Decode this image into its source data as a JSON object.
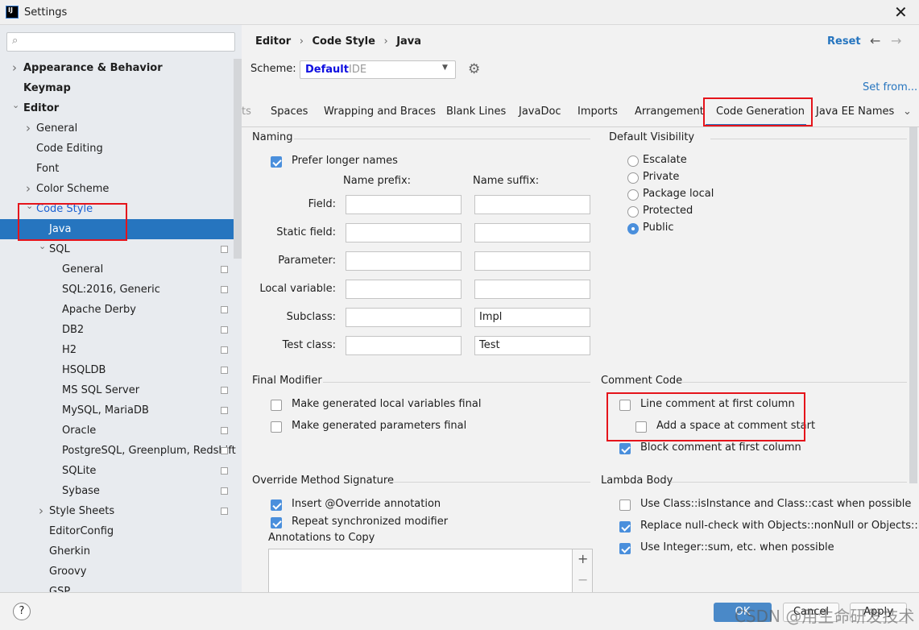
{
  "window": {
    "title": "Settings",
    "logo": "IJ"
  },
  "sidebar": {
    "search_placeholder": "",
    "items": [
      {
        "label": "Appearance & Behavior",
        "level": 0,
        "chevron": "right",
        "bold": true
      },
      {
        "label": "Keymap",
        "level": 0,
        "bold": true
      },
      {
        "label": "Editor",
        "level": 0,
        "chevron": "down",
        "bold": true
      },
      {
        "label": "General",
        "level": 1,
        "chevron": "right"
      },
      {
        "label": "Code Editing",
        "level": 1
      },
      {
        "label": "Font",
        "level": 1
      },
      {
        "label": "Color Scheme",
        "level": 1,
        "chevron": "right"
      },
      {
        "label": "Code Style",
        "level": 1,
        "chevron": "down",
        "link": true
      },
      {
        "label": "Java",
        "level": 2,
        "selected": true
      },
      {
        "label": "SQL",
        "level": 2,
        "chevron": "down",
        "icon": true
      },
      {
        "label": "General",
        "level": 3,
        "icon": true
      },
      {
        "label": "SQL:2016, Generic",
        "level": 3,
        "icon": true
      },
      {
        "label": "Apache Derby",
        "level": 3,
        "icon": true
      },
      {
        "label": "DB2",
        "level": 3,
        "icon": true
      },
      {
        "label": "H2",
        "level": 3,
        "icon": true
      },
      {
        "label": "HSQLDB",
        "level": 3,
        "icon": true
      },
      {
        "label": "MS SQL Server",
        "level": 3,
        "icon": true
      },
      {
        "label": "MySQL, MariaDB",
        "level": 3,
        "icon": true
      },
      {
        "label": "Oracle",
        "level": 3,
        "icon": true
      },
      {
        "label": "PostgreSQL, Greenplum, Redshift",
        "level": 3,
        "icon": true
      },
      {
        "label": "SQLite",
        "level": 3,
        "icon": true
      },
      {
        "label": "Sybase",
        "level": 3,
        "icon": true
      },
      {
        "label": "Style Sheets",
        "level": 2,
        "chevron": "right",
        "icon": true
      },
      {
        "label": "EditorConfig",
        "level": 2
      },
      {
        "label": "Gherkin",
        "level": 2
      },
      {
        "label": "Groovy",
        "level": 2
      },
      {
        "label": "GSP",
        "level": 2
      }
    ]
  },
  "header": {
    "breadcrumb": [
      "Editor",
      "Code Style",
      "Java"
    ],
    "reset": "Reset",
    "scheme_label": "Scheme:",
    "scheme_value": "Default",
    "scheme_suffix": "IDE",
    "set_from": "Set from..."
  },
  "tabs": [
    {
      "label": "ts"
    },
    {
      "label": "Spaces"
    },
    {
      "label": "Wrapping and Braces"
    },
    {
      "label": "Blank Lines"
    },
    {
      "label": "JavaDoc"
    },
    {
      "label": "Imports"
    },
    {
      "label": "Arrangement"
    },
    {
      "label": "Code Generation",
      "selected": true
    },
    {
      "label": "Java EE Names"
    }
  ],
  "naming": {
    "title": "Naming",
    "prefer_longer": {
      "label": "Prefer longer names",
      "checked": true
    },
    "prefix_header": "Name prefix:",
    "suffix_header": "Name suffix:",
    "rows": [
      {
        "label": "Field:",
        "prefix": "",
        "suffix": ""
      },
      {
        "label": "Static field:",
        "prefix": "",
        "suffix": ""
      },
      {
        "label": "Parameter:",
        "prefix": "",
        "suffix": ""
      },
      {
        "label": "Local variable:",
        "prefix": "",
        "suffix": ""
      },
      {
        "label": "Subclass:",
        "prefix": "",
        "suffix": "Impl"
      },
      {
        "label": "Test class:",
        "prefix": "",
        "suffix": "Test"
      }
    ]
  },
  "visibility": {
    "title": "Default Visibility",
    "options": [
      "Escalate",
      "Private",
      "Package local",
      "Protected",
      "Public"
    ],
    "selected": "Public"
  },
  "final_modifier": {
    "title": "Final Modifier",
    "options": [
      {
        "label": "Make generated local variables final",
        "checked": false
      },
      {
        "label": "Make generated parameters final",
        "checked": false
      }
    ]
  },
  "comment_code": {
    "title": "Comment Code",
    "options": [
      {
        "label": "Line comment at first column",
        "checked": false
      },
      {
        "label": "Add a space at comment start",
        "checked": false
      },
      {
        "label": "Block comment at first column",
        "checked": true
      }
    ]
  },
  "override": {
    "title": "Override Method Signature",
    "options": [
      {
        "label": "Insert @Override annotation",
        "checked": true
      },
      {
        "label": "Repeat synchronized modifier",
        "checked": true
      }
    ],
    "annotations_label": "Annotations to Copy",
    "add": "+",
    "remove": "−"
  },
  "lambda": {
    "title": "Lambda Body",
    "options": [
      {
        "label": "Use Class::isInstance and Class::cast when possible",
        "checked": false
      },
      {
        "label": "Replace null-check with Objects::nonNull or Objects::isNull",
        "checked": true
      },
      {
        "label": "Use Integer::sum, etc. when possible",
        "checked": true
      }
    ]
  },
  "footer": {
    "help": "?",
    "ok": "OK",
    "cancel": "Cancel",
    "apply": "Apply"
  },
  "watermark": "CSDN @用生命研发技术",
  "colors": {
    "accent": "#2675bf",
    "highlight": "#e5141b"
  }
}
